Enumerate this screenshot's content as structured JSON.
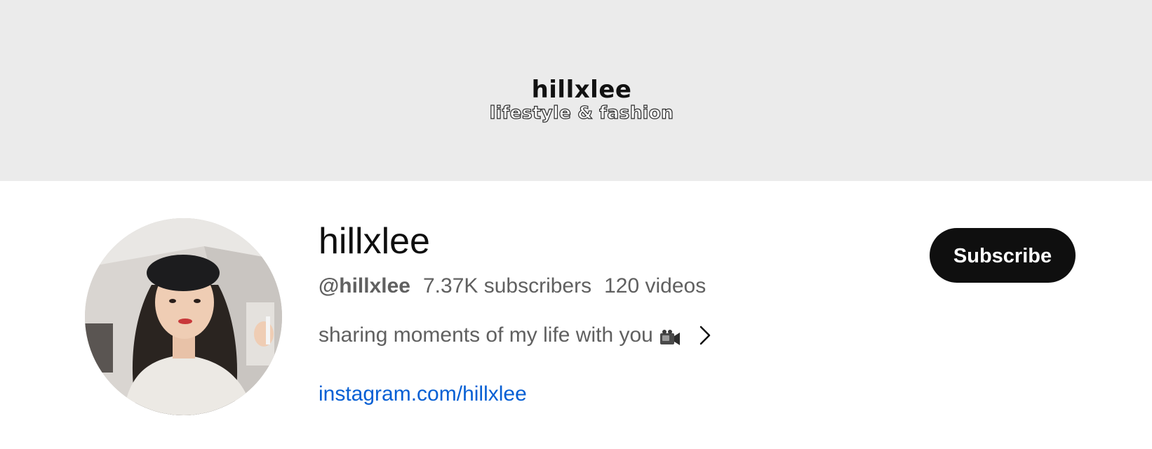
{
  "banner": {
    "title": "hillxlee",
    "subtitle": "lifestyle & fashion"
  },
  "channel": {
    "name": "hillxlee",
    "handle": "@hillxlee",
    "subscribers": "7.37K subscribers",
    "videos": "120 videos",
    "description": "sharing moments of my life with you",
    "description_icon": "video-camera-icon",
    "link": "instagram.com/hillxlee"
  },
  "actions": {
    "subscribe_label": "Subscribe"
  },
  "colors": {
    "banner_bg": "#ebebeb",
    "link": "#065fd4",
    "subscribe_bg": "#0f0f0f",
    "secondary_text": "#606060"
  }
}
